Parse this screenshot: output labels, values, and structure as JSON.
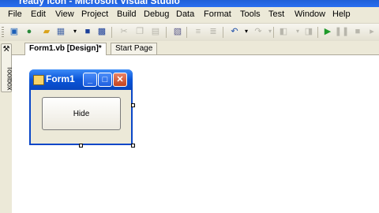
{
  "titlebar": {
    "title": "ready icon - Microsoft Visual Studio"
  },
  "menu": [
    "File",
    "Edit",
    "View",
    "Project",
    "Build",
    "Debug",
    "Data",
    "Format",
    "Tools",
    "Test",
    "Window",
    "Help"
  ],
  "toolbar": {
    "icons": [
      "new-project-icon",
      "add-item-icon",
      "open-icon",
      "grid-icon",
      "dropdown-icon",
      "save-icon",
      "save-all-icon",
      "cut-icon",
      "copy-icon",
      "paste-icon",
      "find-icon",
      "indent-icon",
      "outdent-icon",
      "undo-icon",
      "dropdown-icon",
      "redo-icon",
      "dropdown-icon",
      "navigate-back-icon",
      "navigate-forward-icon",
      "start-icon",
      "pause-icon",
      "stop-icon",
      "step-icon"
    ]
  },
  "toolbox": {
    "label": "Toolbox"
  },
  "tabs": [
    {
      "label": "Form1.vb [Design]*",
      "active": true
    },
    {
      "label": "Start Page",
      "active": false
    }
  ],
  "form": {
    "title": "Form1",
    "button_label": "Hide",
    "caption_buttons": {
      "minimize": "_",
      "maximize": "□",
      "close": "✕"
    }
  }
}
